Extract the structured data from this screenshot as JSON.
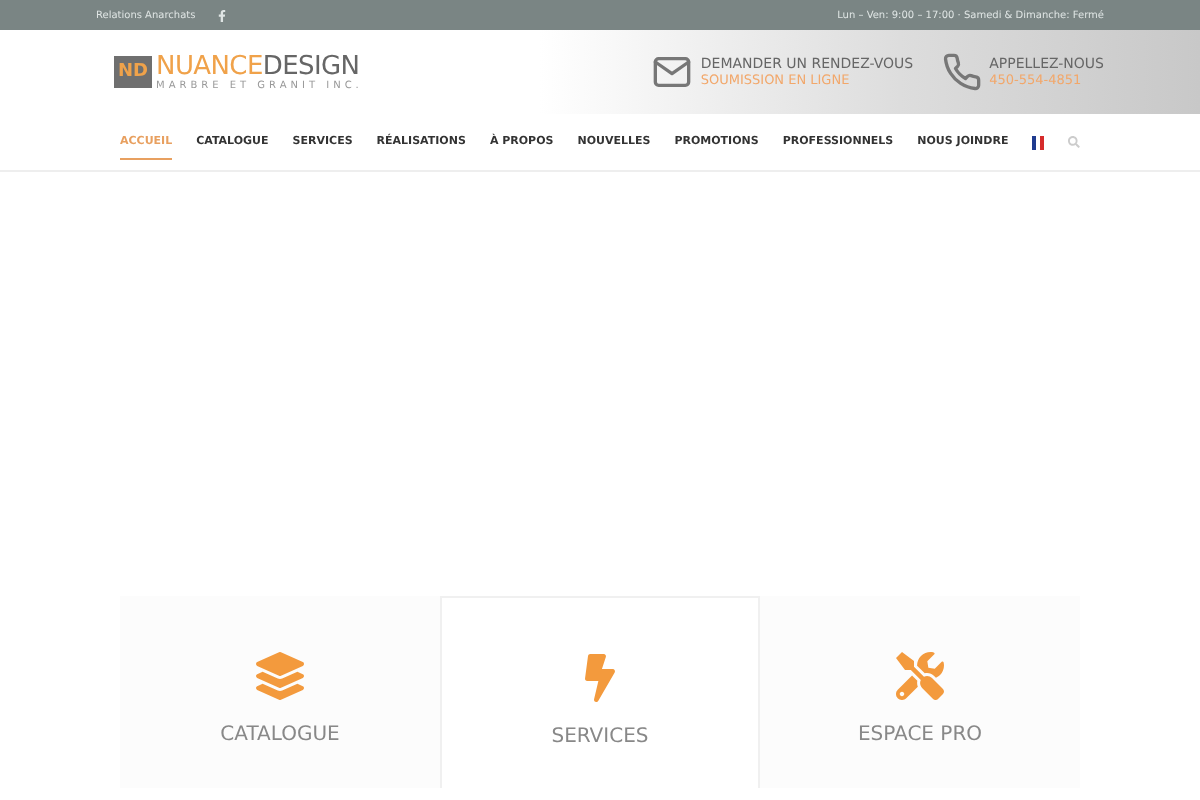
{
  "topbar": {
    "link": "Relations Anarchats",
    "hours": "Lun – Ven: 9:00 – 17:00 · Samedi & Dimanche: Fermé"
  },
  "logo": {
    "mark": "ND",
    "name_1": "NUANCE",
    "name_2": "DESIGN",
    "tagline": "MARBRE ET GRANIT INC."
  },
  "contacts": [
    {
      "kind": "mail",
      "title": "DEMANDER UN RENDEZ-VOUS",
      "link": "SOUMISSION EN LIGNE"
    },
    {
      "kind": "phone",
      "title": "APPELLEZ-NOUS",
      "link": "450-554-4851"
    }
  ],
  "nav": [
    {
      "label": "ACCUEIL",
      "selected": true
    },
    {
      "label": "CATALOGUE",
      "selected": false
    },
    {
      "label": "SERVICES",
      "selected": false
    },
    {
      "label": "RÉALISATIONS",
      "selected": false
    },
    {
      "label": "À PROPOS",
      "selected": false
    },
    {
      "label": "NOUVELLES",
      "selected": false
    },
    {
      "label": "PROMOTIONS",
      "selected": false
    },
    {
      "label": "PROFESSIONNELS",
      "selected": false
    },
    {
      "label": "NOUS JOINDRE",
      "selected": false
    }
  ],
  "features": [
    {
      "kind": "stack",
      "title": "CATALOGUE",
      "selected": false
    },
    {
      "kind": "bolt",
      "title": "SERVICES",
      "selected": true
    },
    {
      "kind": "tools",
      "title": "ESPACE PRO",
      "selected": false
    }
  ]
}
